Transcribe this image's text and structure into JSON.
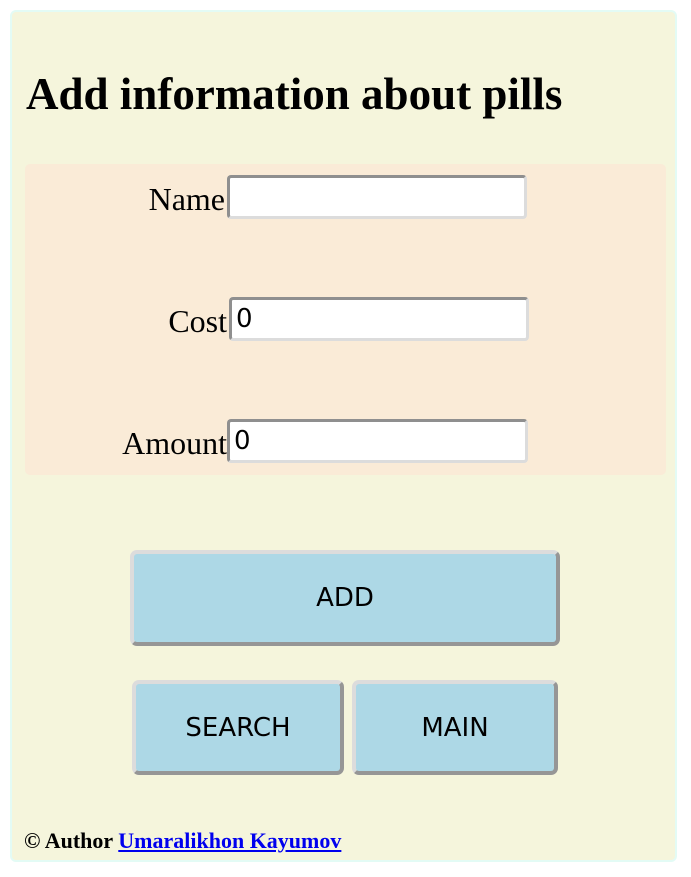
{
  "page": {
    "title": "Add information about pills"
  },
  "form": {
    "name": {
      "label": "Name",
      "value": ""
    },
    "cost": {
      "label": "Cost",
      "value": "0"
    },
    "amount": {
      "label": "Amount",
      "value": "0"
    }
  },
  "buttons": {
    "add": "ADD",
    "search": "SEARCH",
    "main": "MAIN"
  },
  "footer": {
    "prefix": "© Author",
    "author_link": "Umaralikhon Kayumov"
  },
  "colors": {
    "page_background": "#f5f5dc",
    "form_background": "#faebd7",
    "button_background": "#add8e6",
    "link": "#0000ee"
  }
}
